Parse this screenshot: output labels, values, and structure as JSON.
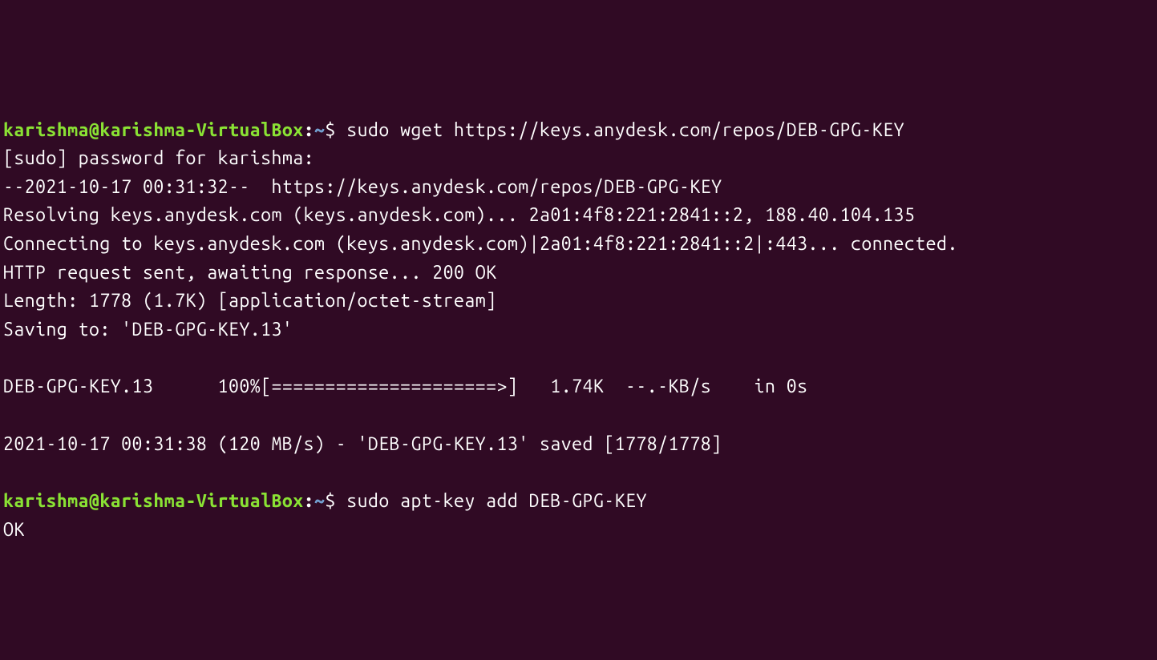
{
  "terminal": {
    "prompt1": {
      "user_host": "karishma@karishma-VirtualBox",
      "separator": ":",
      "path": "~",
      "dollar": "$ ",
      "command": "sudo wget https://keys.anydesk.com/repos/DEB-GPG-KEY"
    },
    "output1": "[sudo] password for karishma: \n--2021-10-17 00:31:32--  https://keys.anydesk.com/repos/DEB-GPG-KEY\nResolving keys.anydesk.com (keys.anydesk.com)... 2a01:4f8:221:2841::2, 188.40.104.135\nConnecting to keys.anydesk.com (keys.anydesk.com)|2a01:4f8:221:2841::2|:443... connected.\nHTTP request sent, awaiting response... 200 OK\nLength: 1778 (1.7K) [application/octet-stream]\nSaving to: 'DEB-GPG-KEY.13'\n\nDEB-GPG-KEY.13      100%[=====================>]   1.74K  --.-KB/s    in 0s\n\n2021-10-17 00:31:38 (120 MB/s) - 'DEB-GPG-KEY.13' saved [1778/1778]\n",
    "prompt2": {
      "user_host": "karishma@karishma-VirtualBox",
      "separator": ":",
      "path": "~",
      "dollar": "$ ",
      "command": "sudo apt-key add DEB-GPG-KEY"
    },
    "output2": "OK"
  }
}
